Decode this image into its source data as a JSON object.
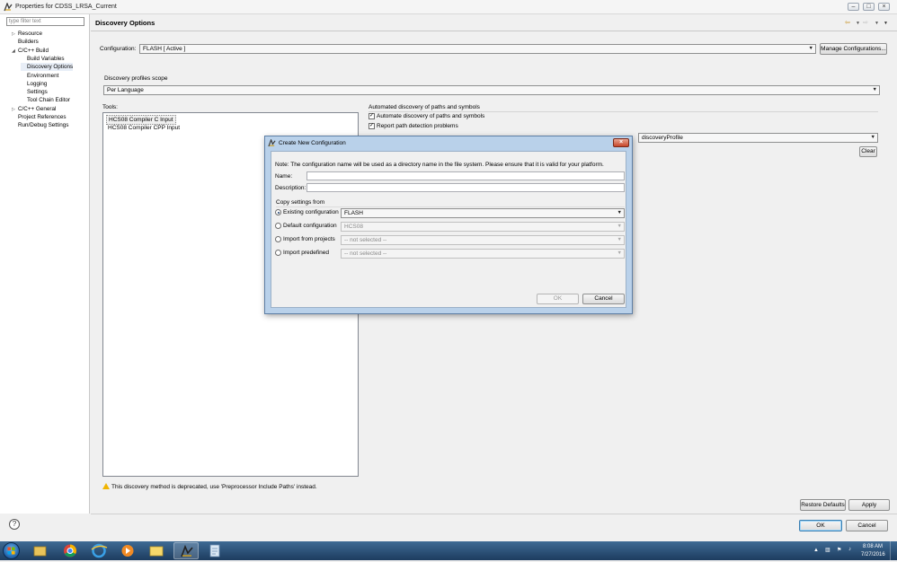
{
  "window": {
    "title": "Properties for CDSS_LRSA_Current"
  },
  "nav": {
    "filter_placeholder": "type filter text",
    "items": [
      {
        "label": "Resource",
        "toggle": "▷"
      },
      {
        "label": "Builders",
        "toggle": ""
      },
      {
        "label": "C/C++ Build",
        "toggle": "◢"
      },
      {
        "label": "Build Variables",
        "toggle": ""
      },
      {
        "label": "Discovery Options",
        "toggle": ""
      },
      {
        "label": "Environment",
        "toggle": ""
      },
      {
        "label": "Logging",
        "toggle": ""
      },
      {
        "label": "Settings",
        "toggle": ""
      },
      {
        "label": "Tool Chain Editor",
        "toggle": ""
      },
      {
        "label": "C/C++ General",
        "toggle": "▷"
      },
      {
        "label": "Project References",
        "toggle": ""
      },
      {
        "label": "Run/Debug Settings",
        "toggle": ""
      }
    ],
    "selected_index": 4
  },
  "header": {
    "title": "Discovery Options"
  },
  "config": {
    "label": "Configuration:",
    "value": "FLASH  [ Active ]",
    "manage_button": "Manage Configurations..."
  },
  "scope": {
    "label": "Discovery profiles scope",
    "value": "Per Language"
  },
  "tools": {
    "label": "Tools:",
    "items": [
      "HCS08 Compiler C Input",
      "HCS08 Compiler CPP Input"
    ]
  },
  "auto": {
    "group_label": "Automated discovery of paths and symbols",
    "automate_label": "Automate discovery of paths and symbols",
    "automate_checked": true,
    "report_label": "Report path detection problems",
    "report_checked": true,
    "profile_value": "discoveryProfile",
    "clear_button": "Clear"
  },
  "warning": {
    "text": "This discovery method is deprecated, use 'Preprocessor Include Paths' instead."
  },
  "footer": {
    "restore": "Restore Defaults",
    "apply": "Apply",
    "ok": "OK",
    "cancel": "Cancel"
  },
  "dialog": {
    "title": "Create New Configuration",
    "note": "Note: The configuration name will be used as a directory name in the file system.  Please ensure that it is valid for your platform.",
    "name_label": "Name:",
    "name_value": "",
    "description_label": "Description:",
    "description_value": "",
    "copy_label": "Copy settings from",
    "options": [
      {
        "label": "Existing configuration",
        "value": "FLASH",
        "selected": true
      },
      {
        "label": "Default configuration",
        "value": "HCS08",
        "selected": false
      },
      {
        "label": "Import from projects",
        "value": "-- not selected --",
        "selected": false
      },
      {
        "label": "Import predefined",
        "value": "-- not selected --",
        "selected": false
      }
    ],
    "ok": "OK",
    "cancel": "Cancel"
  },
  "taskbar": {
    "time": "8:08 AM",
    "date": "7/27/2016"
  },
  "colors": {
    "accent": "#3c7fb1",
    "dialog_frame": "#b9d1ea",
    "warning": "#f0b400"
  },
  "icons": [
    "app-icon",
    "help-icon",
    "back-arrow-icon",
    "forward-arrow-icon",
    "view-menu-icon",
    "warning-icon",
    "close-icon"
  ]
}
